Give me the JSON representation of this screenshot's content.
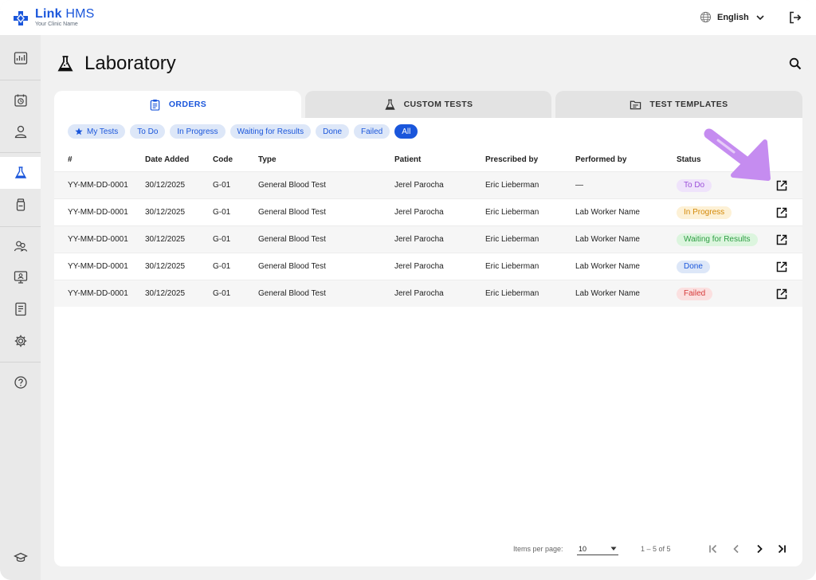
{
  "app": {
    "brand_bold": "Link",
    "brand_thin": " HMS",
    "brand_sub": "Your Clinic Name",
    "language": "English"
  },
  "page": {
    "title": "Laboratory"
  },
  "tabs": [
    {
      "label": "ORDERS",
      "icon": "clipboard-icon",
      "active": true
    },
    {
      "label": "CUSTOM TESTS",
      "icon": "flask-icon",
      "active": false
    },
    {
      "label": "TEST TEMPLATES",
      "icon": "folder-icon",
      "active": false
    }
  ],
  "filters": [
    {
      "label": "My Tests",
      "icon": "star-icon",
      "active": false
    },
    {
      "label": "To Do",
      "active": false
    },
    {
      "label": "In Progress",
      "active": false
    },
    {
      "label": "Waiting for Results",
      "active": false
    },
    {
      "label": "Done",
      "active": false
    },
    {
      "label": "Failed",
      "active": false
    },
    {
      "label": "All",
      "active": true
    }
  ],
  "table": {
    "columns": [
      "#",
      "Date Added",
      "Code",
      "Type",
      "Patient",
      "Prescribed by",
      "Performed by",
      "Status"
    ],
    "rows": [
      {
        "id": "YY-MM-DD-0001",
        "date": "30/12/2025",
        "code": "G-01",
        "type": "General Blood Test",
        "patient": "Jerel Parocha",
        "prescribed": "Eric Lieberman",
        "performed": "—",
        "status": "To Do"
      },
      {
        "id": "YY-MM-DD-0001",
        "date": "30/12/2025",
        "code": "G-01",
        "type": "General Blood Test",
        "patient": "Jerel Parocha",
        "prescribed": "Eric Lieberman",
        "performed": "Lab Worker Name",
        "status": "In Progress"
      },
      {
        "id": "YY-MM-DD-0001",
        "date": "30/12/2025",
        "code": "G-01",
        "type": "General Blood Test",
        "patient": "Jerel Parocha",
        "prescribed": "Eric Lieberman",
        "performed": "Lab Worker Name",
        "status": "Waiting for Results"
      },
      {
        "id": "YY-MM-DD-0001",
        "date": "30/12/2025",
        "code": "G-01",
        "type": "General Blood Test",
        "patient": "Jerel Parocha",
        "prescribed": "Eric Lieberman",
        "performed": "Lab Worker Name",
        "status": "Done"
      },
      {
        "id": "YY-MM-DD-0001",
        "date": "30/12/2025",
        "code": "G-01",
        "type": "General Blood Test",
        "patient": "Jerel Parocha",
        "prescribed": "Eric Lieberman",
        "performed": "Lab Worker Name",
        "status": "Failed"
      }
    ]
  },
  "status_colors": {
    "To Do": {
      "bg": "#efe3fb",
      "fg": "#9b4fd9"
    },
    "In Progress": {
      "bg": "#fdf1d6",
      "fg": "#d48a0a"
    },
    "Waiting for Results": {
      "bg": "#dcf5de",
      "fg": "#2f9e44"
    },
    "Done": {
      "bg": "#dde7f8",
      "fg": "#1a56db"
    },
    "Failed": {
      "bg": "#fbe0e0",
      "fg": "#d63b3b"
    }
  },
  "pagination": {
    "items_per_page_label": "Items per page:",
    "items_per_page": "10",
    "range": "1 – 5 of 5"
  },
  "colors": {
    "accent": "#1a56db",
    "annotation": "#c58cf0"
  }
}
